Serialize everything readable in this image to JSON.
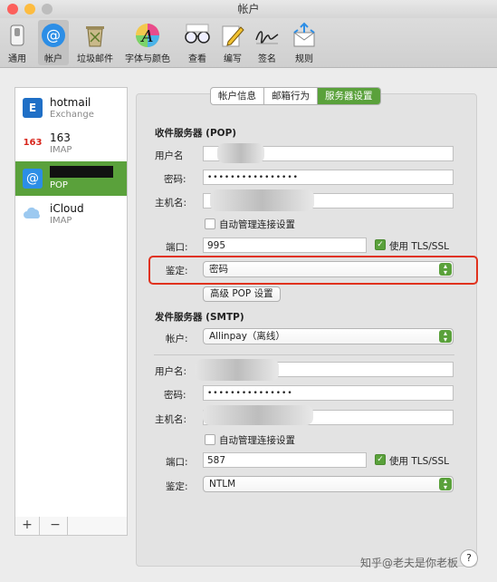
{
  "window": {
    "title": "帐户"
  },
  "toolbar": {
    "items": [
      {
        "label": "通用",
        "icon": "switch-icon"
      },
      {
        "label": "帐户",
        "icon": "at-icon"
      },
      {
        "label": "垃圾邮件",
        "icon": "trash-icon"
      },
      {
        "label": "字体与颜色",
        "icon": "font-color-icon"
      },
      {
        "label": "查看",
        "icon": "glasses-icon"
      },
      {
        "label": "编写",
        "icon": "pencil-icon"
      },
      {
        "label": "签名",
        "icon": "signature-icon"
      },
      {
        "label": "规则",
        "icon": "rules-icon"
      }
    ],
    "selected": "帐户"
  },
  "accounts": [
    {
      "name": "hotmail",
      "type": "Exchange",
      "badge_text": "E"
    },
    {
      "name": "163",
      "type": "IMAP",
      "badge_text": "163"
    },
    {
      "name": "",
      "type": "POP",
      "badge_text": "@"
    },
    {
      "name": "iCloud",
      "type": "IMAP",
      "badge_text": ""
    }
  ],
  "sidebar_footer": {
    "add": "+",
    "remove": "−"
  },
  "tabs": [
    {
      "label": "帐户信息"
    },
    {
      "label": "邮箱行为"
    },
    {
      "label": "服务器设置"
    }
  ],
  "incoming": {
    "section": "收件服务器 (POP)",
    "username_label": "用户名",
    "username_value": "",
    "password_label": "密码:",
    "password_value": "••••••••••••••••",
    "host_label": "主机名:",
    "host_value": "",
    "auto_manage_label": "自动管理连接设置",
    "port_label": "端口:",
    "port_value": "995",
    "tls_label": "使用 TLS/SSL",
    "auth_label": "鉴定:",
    "auth_value": "密码",
    "advanced_button": "高级 POP 设置"
  },
  "outgoing": {
    "section": "发件服务器 (SMTP)",
    "account_label": "帐户:",
    "account_value": "Allinpay（离线）",
    "username_label": "用户名:",
    "username_value": "",
    "password_label": "密码:",
    "password_value": "•••••••••••••••",
    "host_label": "主机名:",
    "host_value": "",
    "auto_manage_label": "自动管理连接设置",
    "port_label": "端口:",
    "port_value": "587",
    "tls_label": "使用 TLS/SSL",
    "auth_label": "鉴定:",
    "auth_value": "NTLM"
  },
  "help": {
    "label": "?"
  },
  "watermark": "知乎@老夫是你老板",
  "colors": {
    "accent": "#5aa13b",
    "highlight": "#e0321e"
  }
}
